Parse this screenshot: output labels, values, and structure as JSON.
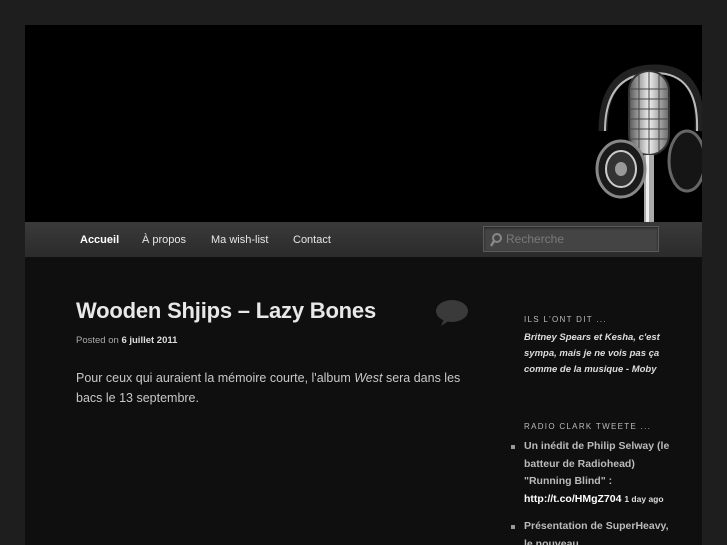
{
  "nav": {
    "items": [
      {
        "label": "Accueil",
        "active": true
      },
      {
        "label": "À propos"
      },
      {
        "label": "Ma wish-list"
      },
      {
        "label": "Contact"
      }
    ],
    "search_placeholder": "Recherche"
  },
  "post": {
    "title": "Wooden Shjips – Lazy Bones",
    "meta_prefix": "Posted on",
    "meta_date": "6 juillet 2011",
    "body_before": "Pour ceux qui auraient la mémoire courte, l'album ",
    "body_italic": "West",
    "body_after": " sera dans les bacs le 13 septembre."
  },
  "sidebar": {
    "quote_title": "ILS L'ONT DIT ...",
    "quote": "Britney Spears et Kesha, c'est sympa, mais je ne vois pas ça comme de la musique - Moby",
    "tweets_title": "RADIO CLARK TWEETE ...",
    "tweets": [
      {
        "text": "Un inédit de Philip Selway (le batteur de Radiohead) \"Running Blind\" : ",
        "link": "http://t.co/HMgZ704",
        "ago": "1 day ago"
      },
      {
        "text": "Présentation de SuperHeavy, le nouveau",
        "link": "",
        "ago": ""
      }
    ]
  },
  "colors": {
    "page_bg": "#1e1e1e",
    "content_bg": "#0f0f0f",
    "nav_bg": "#333333"
  },
  "icons": {
    "header_art": "microphone-headphones-icon",
    "search": "search-icon",
    "comments": "comment-bubble-icon"
  }
}
